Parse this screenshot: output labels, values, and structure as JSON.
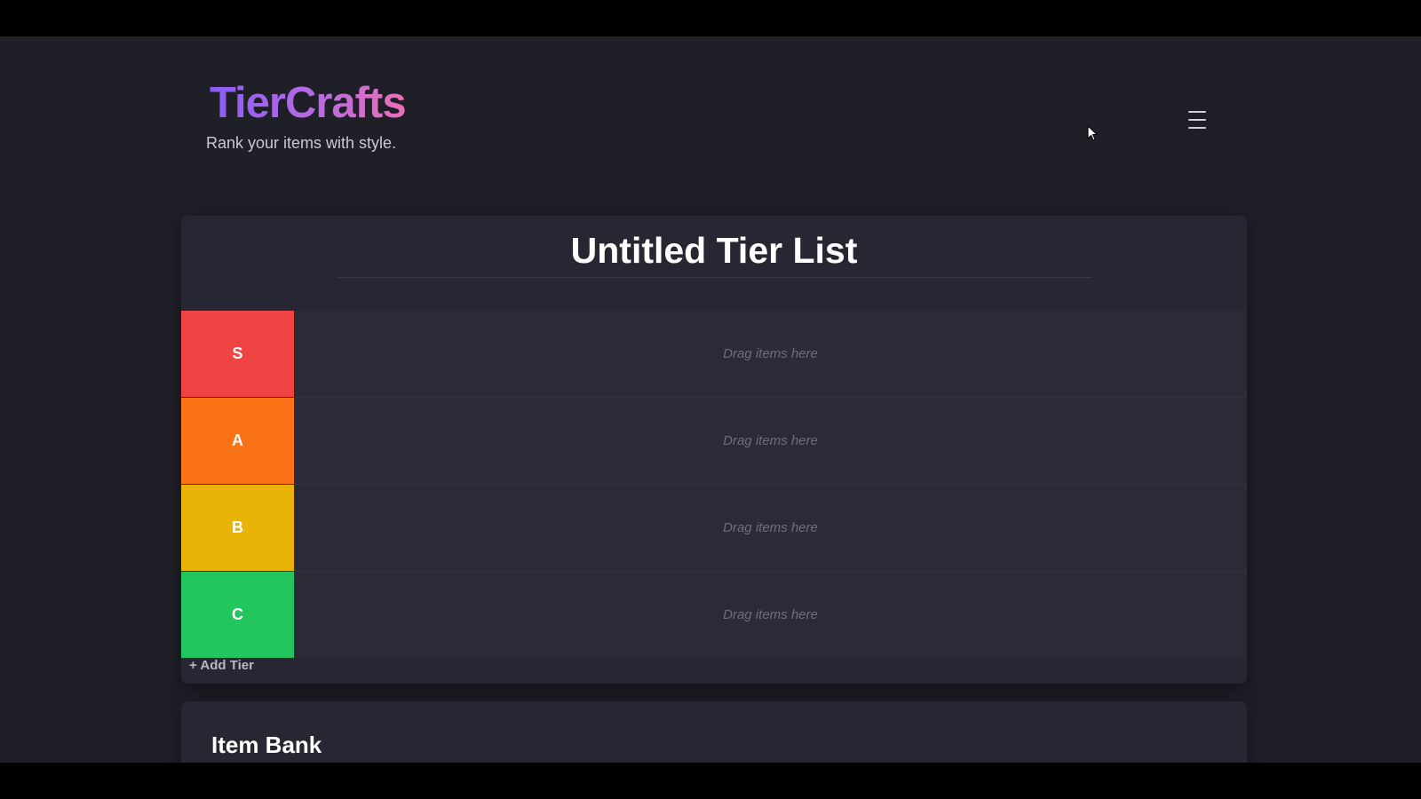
{
  "brand": {
    "title": "TierCrafts",
    "tagline": "Rank your items with style."
  },
  "header": {
    "menu_icon": "hamburger-menu-icon",
    "cursor_icon": "mouse-pointer-icon"
  },
  "tier_list": {
    "title": "Untitled Tier List",
    "tiers": [
      {
        "label": "S",
        "color": "#ef4444",
        "placeholder": "Drag items here"
      },
      {
        "label": "A",
        "color": "#f97316",
        "placeholder": "Drag items here"
      },
      {
        "label": "B",
        "color": "#eab308",
        "placeholder": "Drag items here"
      },
      {
        "label": "C",
        "color": "#22c55e",
        "placeholder": "Drag items here"
      }
    ],
    "add_tier_label": "+ Add Tier"
  },
  "item_bank": {
    "title": "Item Bank"
  },
  "colors": {
    "background": "#1f1f28",
    "card": "#272733",
    "brand_gradient_start": "#8b5cf6",
    "brand_gradient_end": "#ec6fb8"
  }
}
